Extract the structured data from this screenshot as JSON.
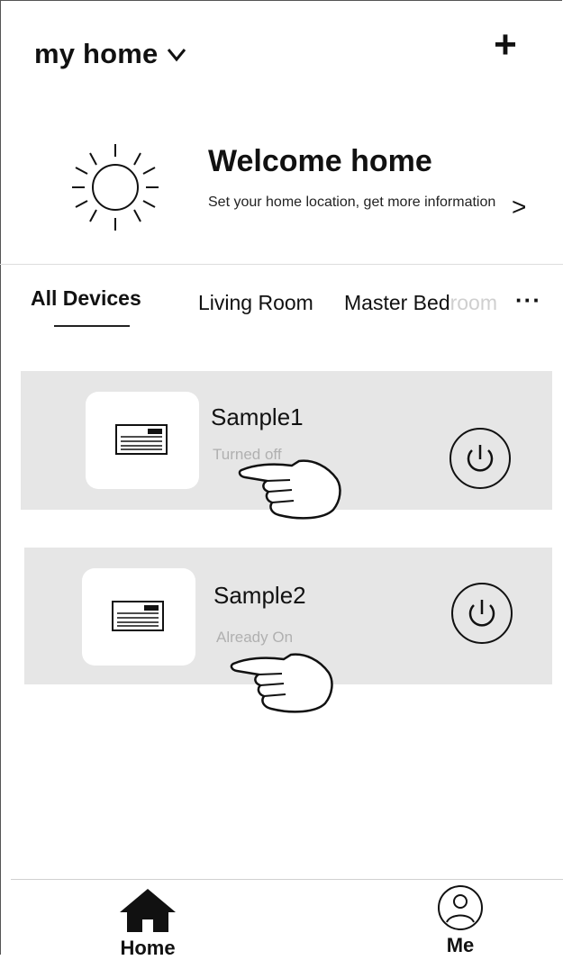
{
  "header": {
    "title": "my home",
    "dropdown_icon": "chevron-down-icon",
    "add_label": "+"
  },
  "welcome": {
    "title": "Welcome home",
    "subtitle": "Set your home location, get more information",
    "arrow": ">",
    "icon": "sun-icon"
  },
  "tabs": [
    {
      "label": "All Devices",
      "active": true
    },
    {
      "label": "Living Room",
      "active": false
    },
    {
      "label_visible": "Master Bed",
      "label_faded": "room"
    }
  ],
  "tabs_more": "···",
  "devices": [
    {
      "name": "Sample1",
      "status": "Turned off",
      "icon": "air-conditioner-icon"
    },
    {
      "name": "Sample2",
      "status": "Already On",
      "icon": "air-conditioner-icon"
    }
  ],
  "bottom_nav": [
    {
      "label": "Home",
      "icon": "home-icon",
      "active": true
    },
    {
      "label": "Me",
      "icon": "user-icon",
      "active": false
    }
  ],
  "colors": {
    "card_bg": "#e6e6e6",
    "status_text": "#b0b0b0",
    "text": "#111111"
  }
}
